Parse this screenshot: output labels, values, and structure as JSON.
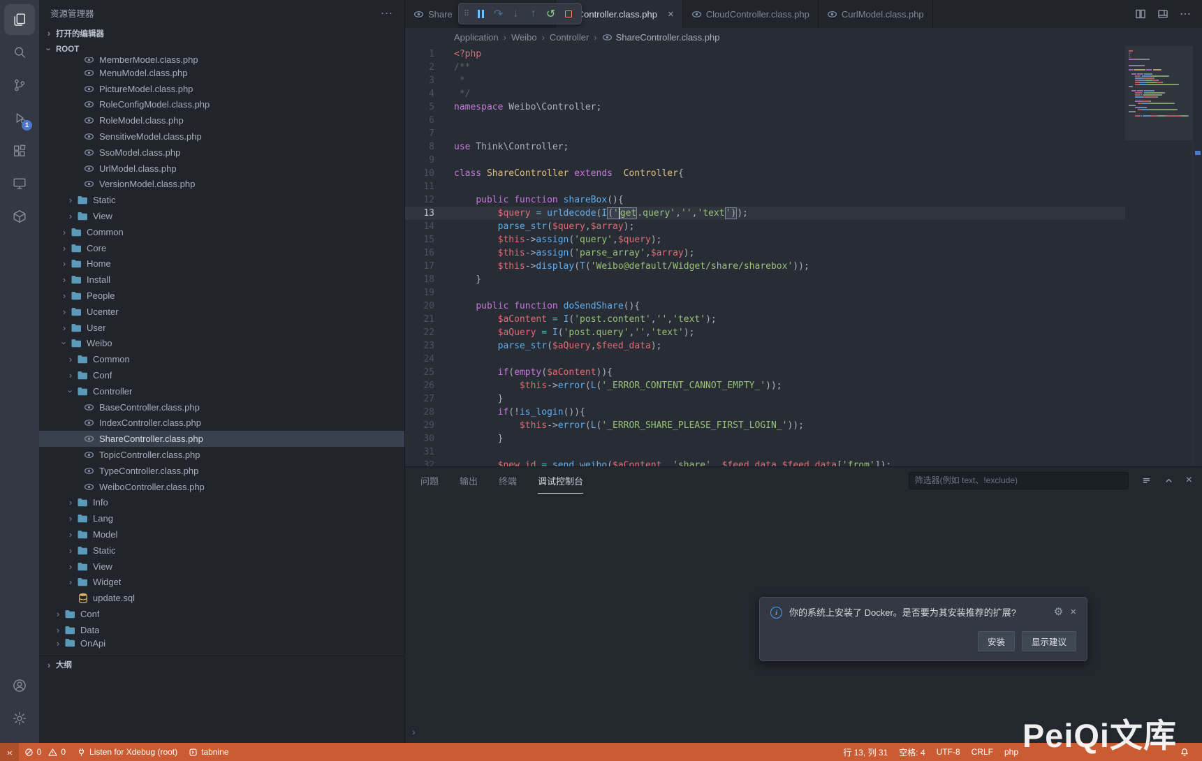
{
  "window": {
    "watermark": "PeiQi文库"
  },
  "colors": {
    "statusbar-bg": "#cb5b32",
    "badge-bg": "#4d78cc",
    "folder-icon": "#5b9ab8",
    "php-icon": "#7e8ba3",
    "sql-icon": "#d8b05f",
    "accent": "#528bff"
  },
  "glyphs": {
    "more": "···",
    "ellipsis": "⋯",
    "close": "×",
    "chevron": "›",
    "prompt": "›",
    "remote": "›‹",
    "gear": "⚙",
    "grip": "⠿"
  },
  "activity_bar": {
    "items": [
      {
        "name": "explorer",
        "active": true
      },
      {
        "name": "search"
      },
      {
        "name": "source-control"
      },
      {
        "name": "run-debug",
        "badge": "1"
      },
      {
        "name": "extensions"
      },
      {
        "name": "remote-explorer"
      },
      {
        "name": "docker"
      }
    ],
    "bottom_items": [
      {
        "name": "accounts"
      },
      {
        "name": "manage"
      }
    ]
  },
  "sidebar": {
    "title": "资源管理器",
    "open_editors_label": "打开的编辑器",
    "root_label": "ROOT",
    "outline_label": "大纲",
    "tree": [
      {
        "l": 4,
        "t": "php",
        "n": "MemberModel.class.php",
        "clip": "top"
      },
      {
        "l": 4,
        "t": "php",
        "n": "MenuModel.class.php"
      },
      {
        "l": 4,
        "t": "php",
        "n": "PictureModel.class.php"
      },
      {
        "l": 4,
        "t": "php",
        "n": "RoleConfigModel.class.php"
      },
      {
        "l": 4,
        "t": "php",
        "n": "RoleModel.class.php"
      },
      {
        "l": 4,
        "t": "php",
        "n": "SensitiveModel.class.php"
      },
      {
        "l": 4,
        "t": "php",
        "n": "SsoModel.class.php"
      },
      {
        "l": 4,
        "t": "php",
        "n": "UrlModel.class.php"
      },
      {
        "l": 4,
        "t": "php",
        "n": "VersionModel.class.php"
      },
      {
        "l": 3,
        "t": "folder",
        "n": "Static"
      },
      {
        "l": 3,
        "t": "folder",
        "n": "View"
      },
      {
        "l": 2,
        "t": "folder",
        "n": "Common"
      },
      {
        "l": 2,
        "t": "folder",
        "n": "Core"
      },
      {
        "l": 2,
        "t": "folder",
        "n": "Home"
      },
      {
        "l": 2,
        "t": "folder",
        "n": "Install"
      },
      {
        "l": 2,
        "t": "folder",
        "n": "People"
      },
      {
        "l": 2,
        "t": "folder",
        "n": "Ucenter"
      },
      {
        "l": 2,
        "t": "folder",
        "n": "User"
      },
      {
        "l": 2,
        "t": "folder",
        "n": "Weibo",
        "exp": true
      },
      {
        "l": 3,
        "t": "folder",
        "n": "Common"
      },
      {
        "l": 3,
        "t": "folder",
        "n": "Conf"
      },
      {
        "l": 3,
        "t": "folder",
        "n": "Controller",
        "exp": true
      },
      {
        "l": 4,
        "t": "php",
        "n": "BaseController.class.php"
      },
      {
        "l": 4,
        "t": "php",
        "n": "IndexController.class.php"
      },
      {
        "l": 4,
        "t": "php",
        "n": "ShareController.class.php",
        "sel": true
      },
      {
        "l": 4,
        "t": "php",
        "n": "TopicController.class.php"
      },
      {
        "l": 4,
        "t": "php",
        "n": "TypeController.class.php"
      },
      {
        "l": 4,
        "t": "php",
        "n": "WeiboController.class.php"
      },
      {
        "l": 3,
        "t": "folder",
        "n": "Info"
      },
      {
        "l": 3,
        "t": "folder",
        "n": "Lang"
      },
      {
        "l": 3,
        "t": "folder",
        "n": "Model"
      },
      {
        "l": 3,
        "t": "folder",
        "n": "Static"
      },
      {
        "l": 3,
        "t": "folder",
        "n": "View"
      },
      {
        "l": 3,
        "t": "folder",
        "n": "Widget"
      },
      {
        "l": 3,
        "t": "sql",
        "n": "update.sql"
      },
      {
        "l": 1,
        "t": "folder",
        "n": "Conf"
      },
      {
        "l": 1,
        "t": "folder",
        "n": "Data"
      },
      {
        "l": 1,
        "t": "folder",
        "n": "OnApi",
        "clip": "bot"
      }
    ]
  },
  "tabs": {
    "items": [
      {
        "label": "Share",
        "icon": "php",
        "partial": true
      },
      {
        "label": "areController.class.php",
        "active": true,
        "close": true
      },
      {
        "label": "CloudController.class.php",
        "icon": "php"
      },
      {
        "label": "CurlModel.class.php",
        "icon": "php"
      }
    ]
  },
  "debug_toolbar": {
    "buttons": [
      {
        "name": "pause",
        "enabled": true
      },
      {
        "name": "step-over",
        "enabled": false
      },
      {
        "name": "step-into",
        "enabled": false
      },
      {
        "name": "step-out",
        "enabled": false
      },
      {
        "name": "restart",
        "enabled": true
      },
      {
        "name": "stop",
        "enabled": true
      }
    ]
  },
  "breadcrumb": {
    "items": [
      "Application",
      "Weibo",
      "Controller",
      "ShareController.class.php"
    ]
  },
  "editor": {
    "active_line": 13,
    "lines": [
      [
        [
          "<?php",
          "v"
        ]
      ],
      [
        [
          "/**",
          "c"
        ]
      ],
      [
        [
          " *",
          "c"
        ]
      ],
      [
        [
          " */",
          "c"
        ]
      ],
      [
        [
          "namespace",
          "k"
        ],
        [
          " Weibo\\Controller;",
          "p"
        ]
      ],
      [],
      [],
      [
        [
          "use",
          "k"
        ],
        [
          " Think\\Controller;",
          "p"
        ]
      ],
      [],
      [
        [
          "class",
          "k"
        ],
        [
          " ",
          "p"
        ],
        [
          "ShareController",
          "t"
        ],
        [
          " ",
          "p"
        ],
        [
          "extends",
          "k"
        ],
        [
          "  ",
          "p"
        ],
        [
          "Controller",
          "t"
        ],
        [
          "{",
          "p"
        ]
      ],
      [],
      [
        [
          "    ",
          "p"
        ],
        [
          "public",
          "k"
        ],
        [
          " ",
          "p"
        ],
        [
          "function",
          "k"
        ],
        [
          " ",
          "p"
        ],
        [
          "shareBox",
          "f"
        ],
        [
          "(){",
          "p"
        ]
      ],
      [
        [
          "        ",
          "p"
        ],
        [
          "$query",
          "v"
        ],
        [
          " ",
          "p"
        ],
        [
          "=",
          "o"
        ],
        [
          " ",
          "p"
        ],
        [
          "urldecode",
          "f"
        ],
        [
          "(",
          "p"
        ],
        [
          "I",
          "f"
        ],
        [
          "(",
          "p",
          "bl"
        ],
        [
          "'",
          "s",
          "br"
        ],
        [
          "get",
          "s",
          "box"
        ],
        [
          ".query'",
          "s"
        ],
        [
          ",",
          "p"
        ],
        [
          "''",
          "s"
        ],
        [
          ",",
          "p"
        ],
        [
          "'text",
          "s"
        ],
        [
          "'",
          "s",
          "bl"
        ],
        [
          ")",
          "p",
          "br"
        ],
        [
          ");",
          "p"
        ]
      ],
      [
        [
          "        ",
          "p"
        ],
        [
          "parse_str",
          "f"
        ],
        [
          "(",
          "p"
        ],
        [
          "$query",
          "v"
        ],
        [
          ",",
          "p"
        ],
        [
          "$array",
          "v"
        ],
        [
          ");",
          "p"
        ]
      ],
      [
        [
          "        ",
          "p"
        ],
        [
          "$this",
          "v"
        ],
        [
          "->",
          "p"
        ],
        [
          "assign",
          "f"
        ],
        [
          "(",
          "p"
        ],
        [
          "'query'",
          "s"
        ],
        [
          ",",
          "p"
        ],
        [
          "$query",
          "v"
        ],
        [
          ");",
          "p"
        ]
      ],
      [
        [
          "        ",
          "p"
        ],
        [
          "$this",
          "v"
        ],
        [
          "->",
          "p"
        ],
        [
          "assign",
          "f"
        ],
        [
          "(",
          "p"
        ],
        [
          "'parse_array'",
          "s"
        ],
        [
          ",",
          "p"
        ],
        [
          "$array",
          "v"
        ],
        [
          ");",
          "p"
        ]
      ],
      [
        [
          "        ",
          "p"
        ],
        [
          "$this",
          "v"
        ],
        [
          "->",
          "p"
        ],
        [
          "display",
          "f"
        ],
        [
          "(",
          "p"
        ],
        [
          "T",
          "f"
        ],
        [
          "(",
          "p"
        ],
        [
          "'Weibo@default/Widget/share/sharebox'",
          "s"
        ],
        [
          "));",
          "p"
        ]
      ],
      [
        [
          "    }",
          "p"
        ]
      ],
      [],
      [
        [
          "    ",
          "p"
        ],
        [
          "public",
          "k"
        ],
        [
          " ",
          "p"
        ],
        [
          "function",
          "k"
        ],
        [
          " ",
          "p"
        ],
        [
          "doSendShare",
          "f"
        ],
        [
          "(){",
          "p"
        ]
      ],
      [
        [
          "        ",
          "p"
        ],
        [
          "$aContent",
          "v"
        ],
        [
          " ",
          "p"
        ],
        [
          "=",
          "o"
        ],
        [
          " ",
          "p"
        ],
        [
          "I",
          "f"
        ],
        [
          "(",
          "p"
        ],
        [
          "'post.content'",
          "s"
        ],
        [
          ",",
          "p"
        ],
        [
          "''",
          "s"
        ],
        [
          ",",
          "p"
        ],
        [
          "'text'",
          "s"
        ],
        [
          ");",
          "p"
        ]
      ],
      [
        [
          "        ",
          "p"
        ],
        [
          "$aQuery",
          "v"
        ],
        [
          " ",
          "p"
        ],
        [
          "=",
          "o"
        ],
        [
          " ",
          "p"
        ],
        [
          "I",
          "f"
        ],
        [
          "(",
          "p"
        ],
        [
          "'post.query'",
          "s"
        ],
        [
          ",",
          "p"
        ],
        [
          "''",
          "s"
        ],
        [
          ",",
          "p"
        ],
        [
          "'text'",
          "s"
        ],
        [
          ");",
          "p"
        ]
      ],
      [
        [
          "        ",
          "p"
        ],
        [
          "parse_str",
          "f"
        ],
        [
          "(",
          "p"
        ],
        [
          "$aQuery",
          "v"
        ],
        [
          ",",
          "p"
        ],
        [
          "$feed_data",
          "v"
        ],
        [
          ");",
          "p"
        ]
      ],
      [],
      [
        [
          "        ",
          "p"
        ],
        [
          "if",
          "k"
        ],
        [
          "(",
          "p"
        ],
        [
          "empty",
          "k"
        ],
        [
          "(",
          "p"
        ],
        [
          "$aContent",
          "v"
        ],
        [
          ")){",
          "p"
        ]
      ],
      [
        [
          "            ",
          "p"
        ],
        [
          "$this",
          "v"
        ],
        [
          "->",
          "p"
        ],
        [
          "error",
          "f"
        ],
        [
          "(",
          "p"
        ],
        [
          "L",
          "f"
        ],
        [
          "(",
          "p"
        ],
        [
          "'_ERROR_CONTENT_CANNOT_EMPTY_'",
          "s"
        ],
        [
          "));",
          "p"
        ]
      ],
      [
        [
          "        }",
          "p"
        ]
      ],
      [
        [
          "        ",
          "p"
        ],
        [
          "if",
          "k"
        ],
        [
          "(!",
          "p"
        ],
        [
          "is_login",
          "f"
        ],
        [
          "()){",
          "p"
        ]
      ],
      [
        [
          "            ",
          "p"
        ],
        [
          "$this",
          "v"
        ],
        [
          "->",
          "p"
        ],
        [
          "error",
          "f"
        ],
        [
          "(",
          "p"
        ],
        [
          "L",
          "f"
        ],
        [
          "(",
          "p"
        ],
        [
          "'_ERROR_SHARE_PLEASE_FIRST_LOGIN_'",
          "s"
        ],
        [
          "));",
          "p"
        ]
      ],
      [
        [
          "        }",
          "p"
        ]
      ],
      [],
      [
        [
          "        ",
          "p"
        ],
        [
          "$new_id",
          "v"
        ],
        [
          " ",
          "p"
        ],
        [
          "=",
          "o"
        ],
        [
          " ",
          "p"
        ],
        [
          "send_weibo",
          "f"
        ],
        [
          "(",
          "p"
        ],
        [
          "$aContent",
          "v"
        ],
        [
          ", ",
          "p"
        ],
        [
          "'share'",
          "s"
        ],
        [
          ", ",
          "p"
        ],
        [
          "$feed_data",
          "v"
        ],
        [
          ",",
          "p"
        ],
        [
          "$feed_data",
          "v"
        ],
        [
          "[",
          "p"
        ],
        [
          "'from'",
          "s"
        ],
        [
          "]);",
          "p"
        ]
      ]
    ]
  },
  "panel": {
    "tabs": [
      {
        "label": "问题"
      },
      {
        "label": "输出"
      },
      {
        "label": "终端"
      },
      {
        "label": "调试控制台",
        "active": true
      }
    ],
    "filter_placeholder": "筛选器(例如 text、!exclude)"
  },
  "notification": {
    "message": "你的系统上安装了 Docker。是否要为其安装推荐的扩展?",
    "buttons": [
      "安装",
      "显示建议"
    ]
  },
  "status_bar": {
    "errors": "0",
    "warnings": "0",
    "debug": "Listen for Xdebug (root)",
    "tabnine": "tabnine",
    "cursor": "行 13, 列 31",
    "indent": "空格: 4",
    "encoding": "UTF-8",
    "eol": "CRLF",
    "language": "php"
  }
}
